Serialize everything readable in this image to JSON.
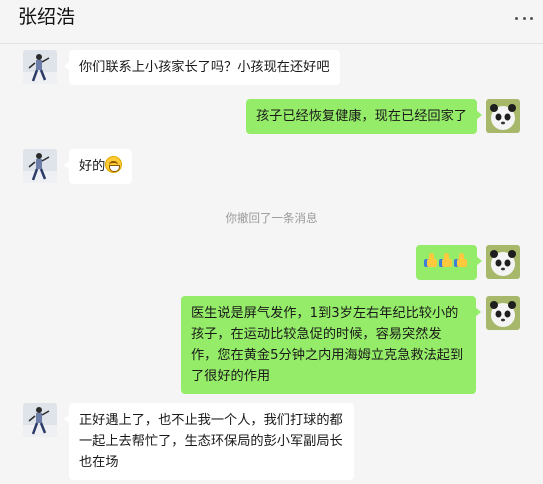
{
  "header": {
    "title": "张绍浩",
    "more_icon": "more-horizontal-icon"
  },
  "messages": [
    {
      "side": "left",
      "text": "你们联系上小孩家长了吗？小孩现在还好吧"
    },
    {
      "side": "right",
      "text": "孩子已经恢复健康，现在已经回家了"
    },
    {
      "side": "left",
      "text": "好的",
      "emoji": "grin-emoji"
    },
    {
      "side": "system",
      "text": "你撤回了一条消息"
    },
    {
      "side": "right",
      "emoji": "thumbs-up-emoji x3"
    },
    {
      "side": "right",
      "text": "医生说是屏气发作，1到3岁左右年纪比较小的孩子，在运动比较急促的时候，容易突然发作，您在黄金5分钟之内用海姆立克急救法起到了很好的作用"
    },
    {
      "side": "left",
      "text": "正好遇上了，也不止我一个人，我们打球的都一起上去帮忙了，生态环保局的彭小军副局长也在场"
    }
  ],
  "colors": {
    "background": "#f5f5f5",
    "incoming_bubble": "#ffffff",
    "outgoing_bubble": "#95ec69"
  }
}
